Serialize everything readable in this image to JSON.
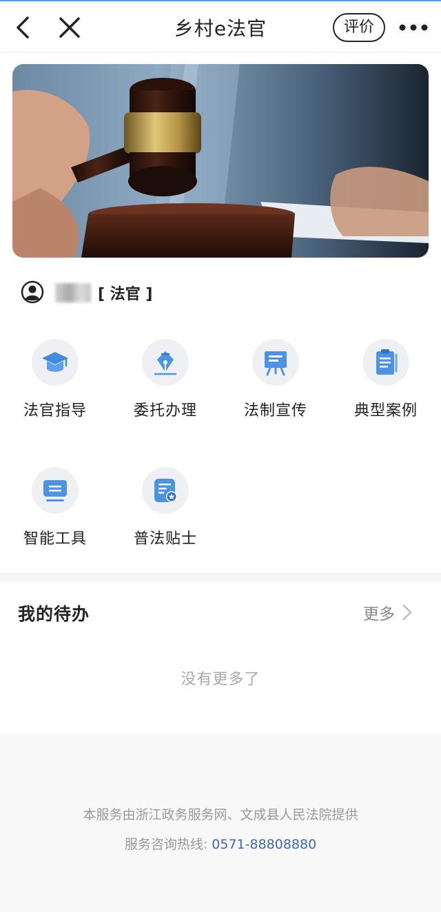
{
  "header": {
    "title": "乡村e法官",
    "rate_label": "评价"
  },
  "user": {
    "role": "[ 法官 ]"
  },
  "grid": [
    {
      "label": "法官指导",
      "icon": "graduation-cap-icon"
    },
    {
      "label": "委托办理",
      "icon": "pen-nib-icon"
    },
    {
      "label": "法制宣传",
      "icon": "easel-board-icon"
    },
    {
      "label": "典型案例",
      "icon": "document-icon"
    },
    {
      "label": "智能工具",
      "icon": "monitor-icon"
    },
    {
      "label": "普法贴士",
      "icon": "badge-card-icon"
    }
  ],
  "todo": {
    "title": "我的待办",
    "more_label": "更多",
    "empty_text": "没有更多了"
  },
  "footer": {
    "provider_text": "本服务由浙江政务服务网、文成县人民法院提供",
    "hotline_label": "服务咨询热线:",
    "hotline_number": "0571-88808880"
  },
  "colors": {
    "icon_blue": "#4a90e2",
    "link_blue": "#3e6bb0",
    "icon_bg": "#eef0f4"
  }
}
